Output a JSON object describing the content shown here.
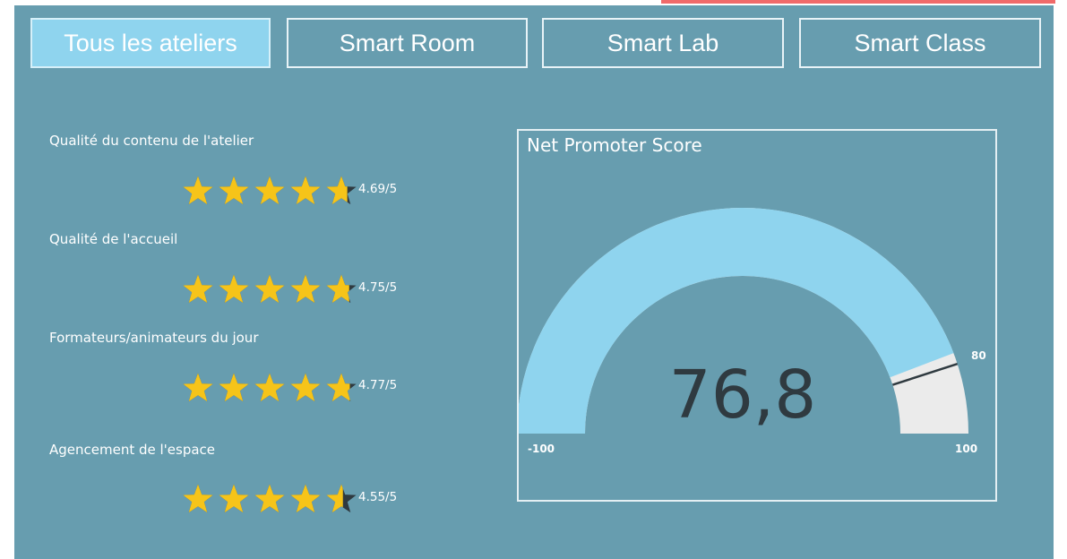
{
  "tabs": [
    {
      "label": "Tous les ateliers",
      "active": true
    },
    {
      "label": "Smart Room",
      "active": false
    },
    {
      "label": "Smart Lab",
      "active": false
    },
    {
      "label": "Smart Class",
      "active": false
    }
  ],
  "ratings": [
    {
      "label": "Qualité du contenu de l'atelier",
      "value_text": "4.69/5",
      "value": 4.69,
      "max": 5
    },
    {
      "label": "Qualité de l'accueil",
      "value_text": "4.75/5",
      "value": 4.75,
      "max": 5
    },
    {
      "label": "Formateurs/animateurs du jour",
      "value_text": "4.77/5",
      "value": 4.77,
      "max": 5
    },
    {
      "label": "Agencement de l'espace",
      "value_text": "4.55/5",
      "value": 4.55,
      "max": 5
    }
  ],
  "gauge": {
    "title": "Net Promoter Score",
    "value": 76.8,
    "value_text": "76,8",
    "min": -100,
    "max": 100,
    "target": 80,
    "min_label": "-100",
    "max_label": "100",
    "target_label": "80"
  },
  "colors": {
    "panel": "#679daf",
    "tab_active": "#8fd4ee",
    "star": "#f6c419",
    "star_empty": "#2f3a40",
    "gauge_fill": "#8fd4ee",
    "gauge_track": "#ebebeb",
    "accent_bar": "#f06a6a"
  }
}
